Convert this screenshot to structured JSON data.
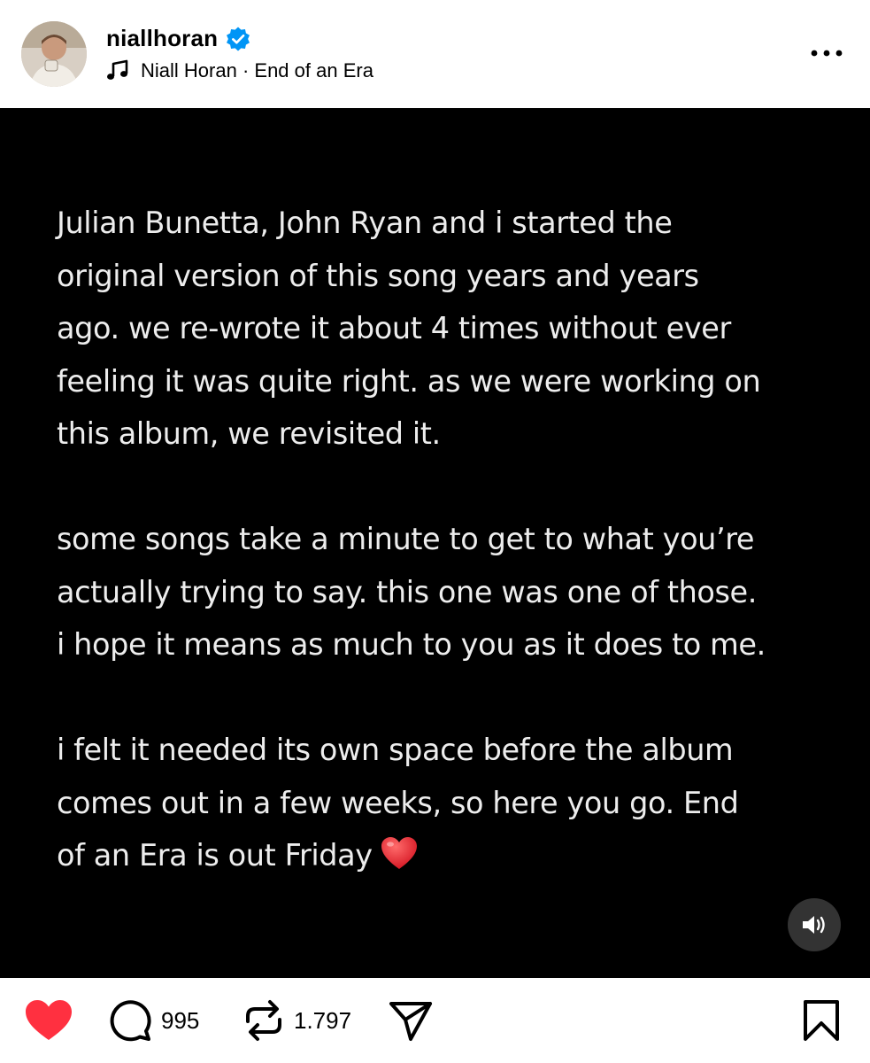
{
  "post": {
    "username": "niallhoran",
    "verified": true,
    "music": {
      "artist": "Niall Horan",
      "separator": " · ",
      "track": "End of an Era"
    }
  },
  "caption": {
    "paragraphs": [
      "Julian Bunetta, John Ryan and i started the\noriginal version of this song years and years\nago. we re-wrote it about 4 times without ever\nfeeling it was quite right. as we were working on\nthis album, we revisited it.",
      "some songs take a minute to get to what you’re\nactually trying to say. this one was one of those.\ni hope it means as much to you as it does to me.",
      "i felt it needed its own space before the album\ncomes out in a few weeks, so here you go. End\nof an Era is out Friday"
    ],
    "trailing_emoji": "red-heart-emoji"
  },
  "actions": {
    "liked": true,
    "comments_count": "995",
    "reposts_count": "1.797"
  },
  "colors": {
    "like_red": "#ff3040",
    "verified_blue": "#0095f6",
    "media_bg": "#000000",
    "caption_text": "#ededed"
  },
  "icons": {
    "header": [
      "verified-badge-icon",
      "music-note-icon",
      "more-options-icon"
    ],
    "media": [
      "sound-on-icon"
    ],
    "actions": [
      "heart-icon",
      "comment-icon",
      "repost-icon",
      "share-icon",
      "bookmark-icon"
    ]
  }
}
